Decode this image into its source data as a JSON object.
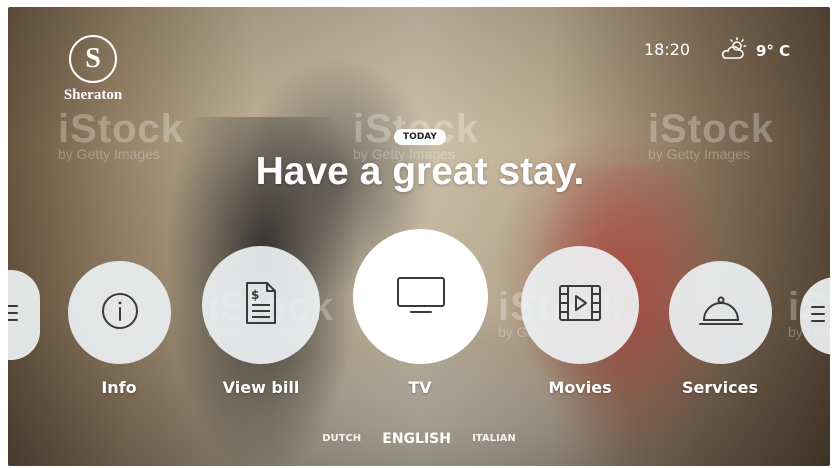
{
  "brand": {
    "name": "Sheraton",
    "seal_letter": "S"
  },
  "status": {
    "time": "18:20",
    "temperature": "9° C",
    "weather_icon": "partly-cloudy-sun-icon"
  },
  "hero": {
    "badge": "TODAY",
    "headline": "Have a great stay."
  },
  "menu": {
    "items": [
      {
        "label": "",
        "icon": "list-icon"
      },
      {
        "label": "Info",
        "icon": "info-icon"
      },
      {
        "label": "View bill",
        "icon": "bill-icon"
      },
      {
        "label": "TV",
        "icon": "tv-icon",
        "selected": true
      },
      {
        "label": "Movies",
        "icon": "film-icon"
      },
      {
        "label": "Services",
        "icon": "cloche-icon"
      },
      {
        "label": "",
        "icon": "list-icon"
      }
    ]
  },
  "languages": {
    "left": "DUTCH",
    "current": "ENGLISH",
    "right": "ITALIAN"
  },
  "watermark": {
    "brand": "iStock",
    "sub": "by Getty Images"
  },
  "colors": {
    "text": "#ffffff",
    "circle": "#eceff1",
    "icon": "#3a3a3a"
  }
}
